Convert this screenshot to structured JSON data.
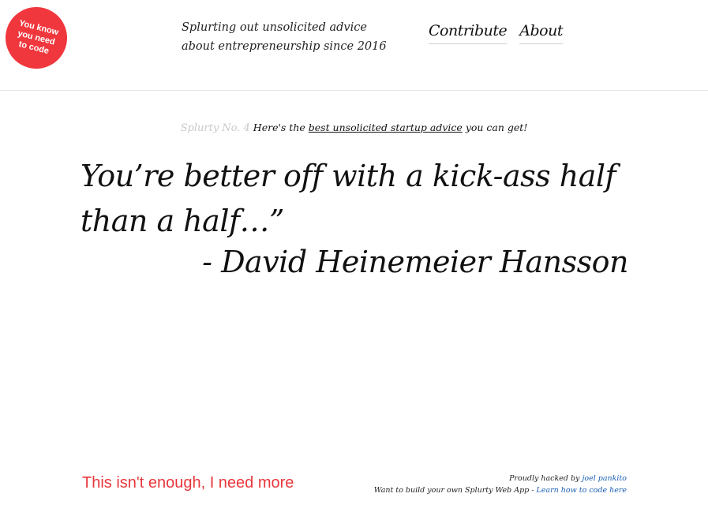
{
  "badge": {
    "text": "You know\nyou need\nto code",
    "color": "#f0373d"
  },
  "header": {
    "tagline": "Splurting out unsolicited advice about entrepreneurship since 2016",
    "nav": [
      {
        "label": "Contribute"
      },
      {
        "label": "About"
      }
    ]
  },
  "intro": {
    "number": "Splurty No. 4",
    "prefix": "Here's the",
    "link": "best unsolicited startup advice",
    "suffix": "you can get!"
  },
  "quote": {
    "text": "You’re better off with a kick-ass half than a half…”",
    "author": "- David Heinemeier Hansson"
  },
  "footer": {
    "more_link": "This isn't enough, I need more",
    "credit_prefix": "Proudly hacked by",
    "credit_name": "joel pankito",
    "build_prefix": "Want to build your own Splurty Web App -",
    "build_link": "Learn how to code here",
    "accent_color": "#e8373c",
    "link_color": "#1a5fb4"
  }
}
